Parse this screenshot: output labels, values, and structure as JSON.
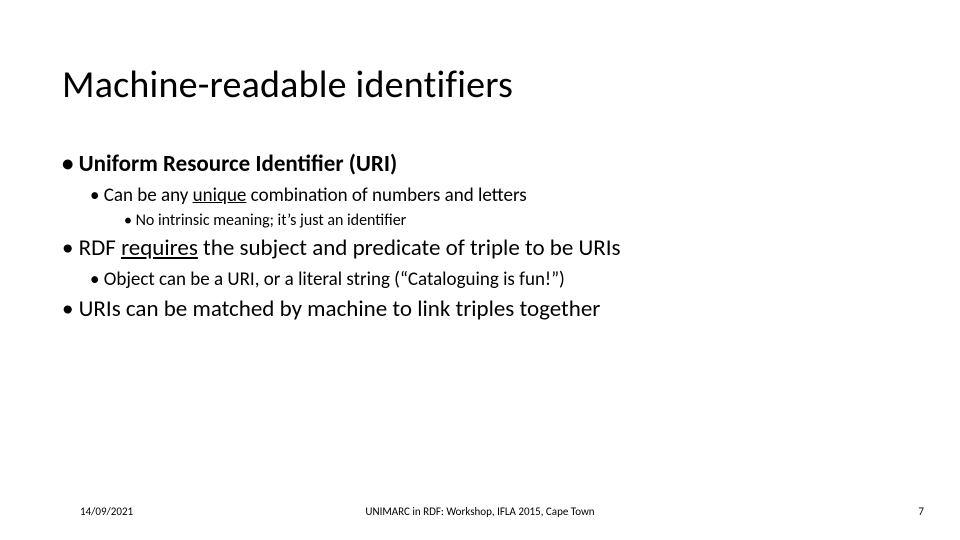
{
  "title": "Machine-readable identifiers",
  "b1": "Uniform Resource Identifier (URI)",
  "b1_1_pre": "Can be any ",
  "b1_1_u": "unique",
  "b1_1_post": " combination of numbers and letters",
  "b1_1_1": "No intrinsic meaning; it’s just an identifier",
  "b2_pre": "RDF ",
  "b2_u": "requires",
  "b2_post": " the subject and predicate of triple to be URIs",
  "b2_1": "Object can be a URI, or a literal string (“Cataloguing is fun!”)",
  "b3": "URIs can be matched by machine to link triples together",
  "footer_date": "14/09/2021",
  "footer_center": "UNIMARC in RDF: Workshop, IFLA 2015, Cape Town",
  "footer_num": "7"
}
